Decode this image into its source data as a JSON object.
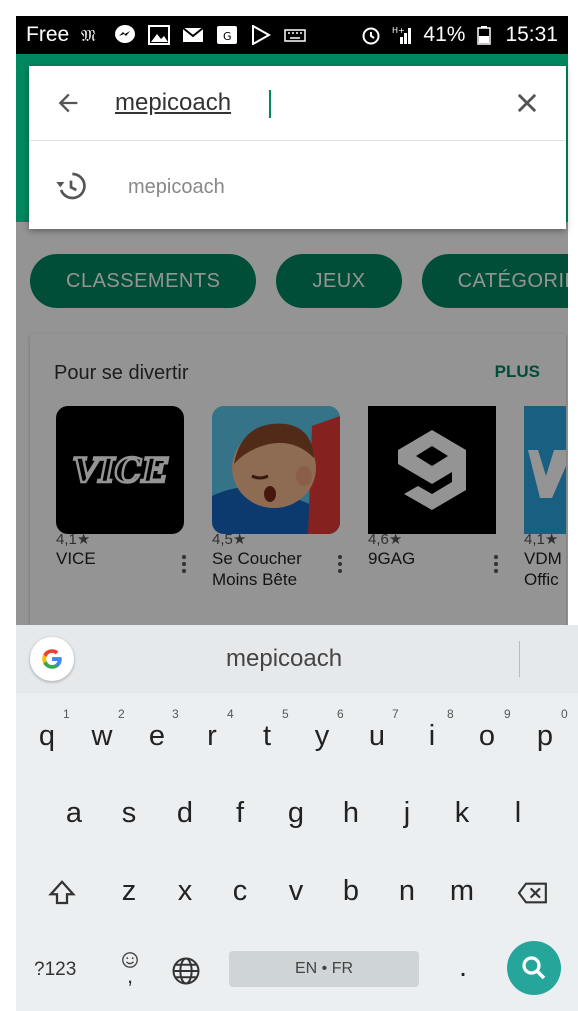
{
  "status_bar": {
    "carrier": "Free",
    "battery": "41%",
    "time": "15:31",
    "network": "H+"
  },
  "search": {
    "query": "mepicoach",
    "back_icon": "arrow-back-icon",
    "clear_icon": "close-icon",
    "suggestions": [
      {
        "icon": "history-icon",
        "text": "mepicoach"
      }
    ]
  },
  "background": {
    "chips": [
      "CLASSEMENTS",
      "JEUX",
      "CATÉGORIE"
    ],
    "section_title": "Pour se divertir",
    "section_more": "PLUS",
    "apps": [
      {
        "name": "VICE",
        "rating": "4,1★"
      },
      {
        "name": "Se Coucher Moins Bête",
        "rating": "4,5★"
      },
      {
        "name": "9GAG",
        "rating": "4,6★"
      },
      {
        "name": "VDM Offic",
        "rating": "4,1★"
      }
    ],
    "vice_logo_text": "VICE"
  },
  "keyboard": {
    "suggestion": "mepicoach",
    "row1": [
      "q",
      "w",
      "e",
      "r",
      "t",
      "y",
      "u",
      "i",
      "o",
      "p"
    ],
    "row1_hints": [
      "1",
      "2",
      "3",
      "4",
      "5",
      "6",
      "7",
      "8",
      "9",
      "0"
    ],
    "row2": [
      "a",
      "s",
      "d",
      "f",
      "g",
      "h",
      "j",
      "k",
      "l"
    ],
    "row3": [
      "z",
      "x",
      "c",
      "v",
      "b",
      "n",
      "m"
    ],
    "symbols_label": "?123",
    "emoji_comma": ",",
    "space_label": "EN • FR",
    "period": ".",
    "colors": {
      "accent": "#01875f",
      "search_button": "#26a69a"
    }
  }
}
